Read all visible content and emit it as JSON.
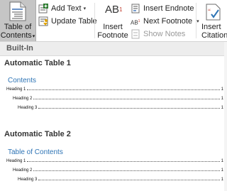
{
  "ribbon": {
    "toc_button": {
      "line1": "Table of",
      "line2": "Contents",
      "caret": "▾",
      "icon": "table-of-contents-icon"
    },
    "add_text": {
      "label": "Add Text",
      "caret": "▾",
      "icon": "add-text-icon"
    },
    "update_table": {
      "label": "Update Table",
      "icon": "update-table-icon"
    },
    "insert_footnote": {
      "line1": "Insert",
      "line2": "Footnote",
      "icon_text": "AB",
      "icon_sup": "1"
    },
    "insert_endnote": {
      "label": "Insert Endnote",
      "icon": "insert-endnote-icon"
    },
    "next_footnote": {
      "label": "Next Footnote",
      "caret": "▾",
      "icon_text": "AB",
      "icon_sup": "1"
    },
    "show_notes": {
      "label": "Show Notes",
      "icon": "show-notes-icon"
    },
    "insert_citation": {
      "line1": "Insert",
      "line2": "Citation",
      "icon": "insert-citation-icon"
    }
  },
  "gallery": {
    "section_header": "Built-In",
    "entries": [
      {
        "title": "Automatic Table 1",
        "heading": "Contents",
        "lines": [
          {
            "text": "Heading 1",
            "page": "1"
          },
          {
            "text": "Heading 2",
            "page": "1"
          },
          {
            "text": "Heading 3",
            "page": "1"
          }
        ]
      },
      {
        "title": "Automatic Table 2",
        "heading": "Table of Contents",
        "lines": [
          {
            "text": "Heading 1",
            "page": "1"
          },
          {
            "text": "Heading 2",
            "page": "1"
          },
          {
            "text": "Heading 3",
            "page": "1"
          }
        ]
      }
    ]
  }
}
